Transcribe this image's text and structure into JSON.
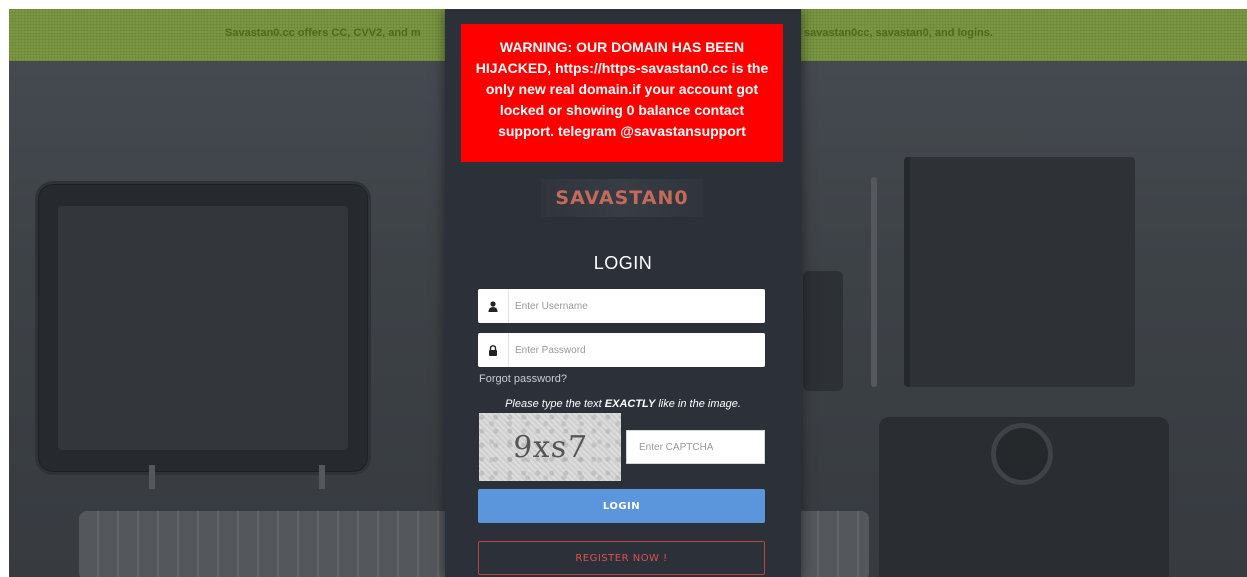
{
  "banner": {
    "left_text": "Savastan0.cc offers CC, CVV2, and m",
    "right_text": "savastan0cc, savastan0, and logins."
  },
  "warning": {
    "text": "WARNING: OUR DOMAIN HAS BEEN HIJACKED, https://https-savastan0.cc is the only new real domain.if your account got locked or showing 0 balance contact support. telegram @savastansupport",
    "background": "#ff0000"
  },
  "logo": {
    "text": "SAVASTAN0"
  },
  "login": {
    "title": "LOGIN",
    "username_placeholder": "Enter Username",
    "password_placeholder": "Enter Password",
    "forgot_link": "Forgot password?",
    "captcha_instruction_pre": "Please type the text ",
    "captcha_instruction_emphasis": "EXACTLY",
    "captcha_instruction_post": " like in the image.",
    "captcha_image_text": "9xs7",
    "captcha_placeholder": "Enter CAPTCHA",
    "login_button": "LOGIN",
    "register_button": "REGISTER NOW !"
  },
  "icons": {
    "username": "user-icon",
    "password": "lock-icon"
  },
  "colors": {
    "panel": "#2c3038",
    "login_button": "#5b95db",
    "register_border": "#b5453f",
    "banner": "#7a9742"
  }
}
